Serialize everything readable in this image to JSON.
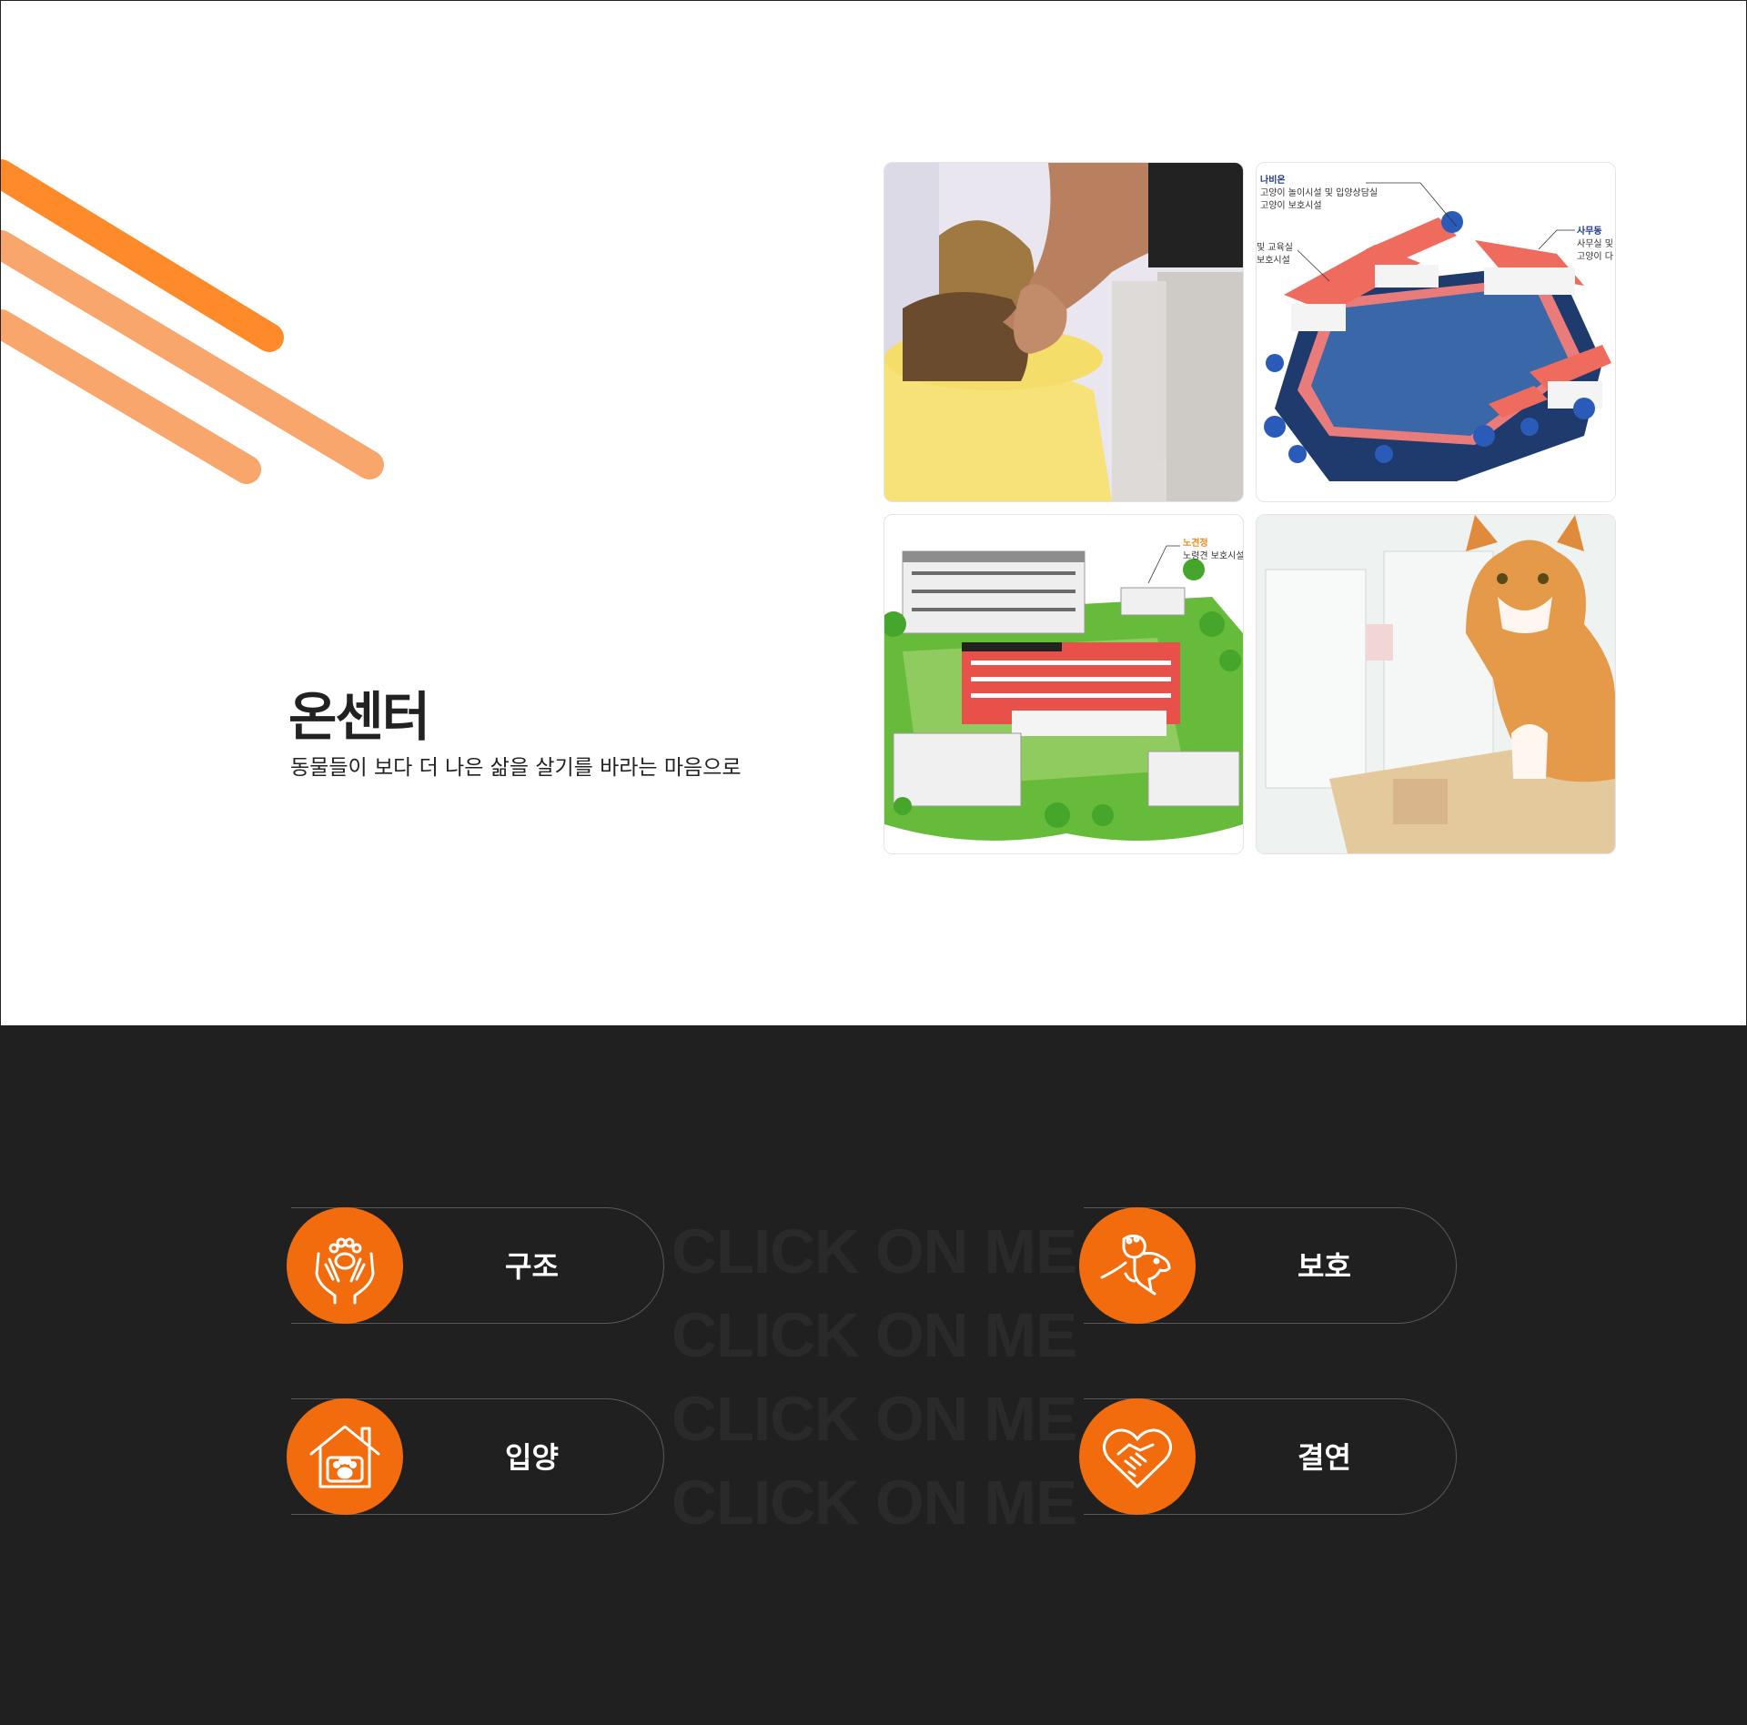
{
  "hero": {
    "title": "온센터",
    "subtitle": "동물들이 보다 더 나은 삶을 살기를 바라는 마음으로"
  },
  "gallery": {
    "map1": {
      "label_a_title": "나비온",
      "label_a_line1": "고양이 놀이시설 및 입양상담실",
      "label_a_line2": "고양이 보호시설",
      "label_b_line1": "및 교육실",
      "label_b_line2": "보호시설",
      "label_c_title": "사무동",
      "label_c_line1": "사무실 및",
      "label_c_line2": "고양이 다"
    },
    "map2": {
      "label_title": "노견정",
      "label_line1": "노령견 보호시설"
    }
  },
  "watermark": [
    "CLICK ON ME",
    "CLICK ON ME",
    "CLICK ON ME",
    "CLICK ON ME"
  ],
  "buttons": {
    "rescue": "구조",
    "protect": "보호",
    "adopt": "입양",
    "bond": "결연"
  },
  "colors": {
    "accent": "#f26c0d",
    "stripe_dark": "#ff8a2a",
    "stripe_light": "#f9a66c",
    "dark_bg": "#202020"
  },
  "icons": {
    "rescue": "hands-paw-icon",
    "protect": "dog-paw-hand-icon",
    "adopt": "house-paw-icon",
    "bond": "heart-handshake-icon"
  }
}
